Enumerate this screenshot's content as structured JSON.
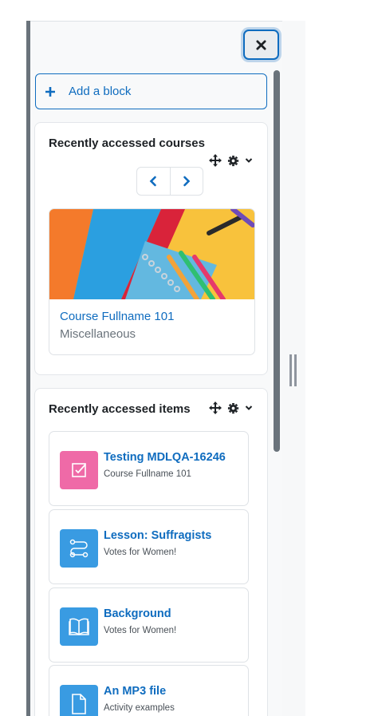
{
  "drawer": {
    "close_label": "close-drawer",
    "add_block_label": "Add a block"
  },
  "recent_courses": {
    "title": "Recently accessed courses",
    "courses": [
      {
        "name": "Course Fullname 101",
        "category": "Miscellaneous"
      }
    ]
  },
  "recent_items": {
    "title": "Recently accessed items",
    "items": [
      {
        "name": "Testing MDLQA-16246",
        "course": "Course Fullname 101",
        "icon": "assignment-icon",
        "color": "#ef6aa7"
      },
      {
        "name": "Lesson: Suffragists",
        "course": "Votes for Women!",
        "icon": "lesson-icon",
        "color": "#399be2"
      },
      {
        "name": "Background",
        "course": "Votes for Women!",
        "icon": "book-icon",
        "color": "#399be2"
      },
      {
        "name": "An MP3 file",
        "course": "Activity examples",
        "icon": "file-icon",
        "color": "#399be2"
      }
    ]
  },
  "colors": {
    "accent": "#0f6cbf",
    "drawer_bg": "#f8f9fa"
  }
}
